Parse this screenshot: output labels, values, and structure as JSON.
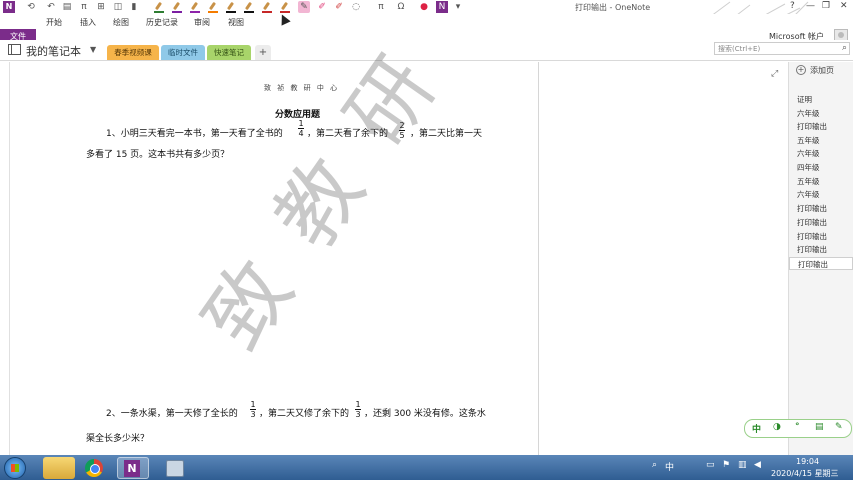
{
  "window": {
    "title": "打印输出 - OneNote",
    "account": "Microsoft 帐户"
  },
  "ribbon": {
    "file": "文件",
    "tabs": [
      "开始",
      "插入",
      "绘图",
      "历史记录",
      "审阅",
      "视图"
    ]
  },
  "quick_access_icons": [
    "back-icon",
    "pi-icon",
    "table-icon",
    "paint-icon"
  ],
  "pen_colors": [
    "#2e7d32",
    "#7b1fa2",
    "#8e24aa",
    "#f57c00",
    "#111111",
    "#111111",
    "#c62828",
    "#c62828"
  ],
  "notebook": {
    "name": "我的笔记本",
    "sections": [
      "春季视频课",
      "临时文件",
      "快速笔记"
    ],
    "add_section": "+"
  },
  "search": {
    "placeholder": "搜索(Ctrl+E)"
  },
  "pages_panel": {
    "add_page": "添加页",
    "pages": [
      "证明",
      "六年级",
      "打印输出",
      "五年级",
      "六年级",
      "四年级",
      "五年级",
      "六年级",
      "打印输出",
      "打印输出",
      "打印输出",
      "打印输出",
      "打印输出"
    ],
    "selected_index": 12
  },
  "document": {
    "header": "致 祯 教 研 中 心",
    "title": "分数应用题",
    "q1": {
      "part1": "1、小明三天看完一本书，第一天看了全书的",
      "frac1": {
        "num": "1",
        "den": "4"
      },
      "part2": "，第二天看了余下的",
      "frac2": {
        "num": "2",
        "den": "5"
      },
      "part3": "，第二天比第一天",
      "line2": "多看了 15 页。这本书共有多少页？"
    },
    "q2": {
      "part1": "2、一条水渠，第一天修了全长的",
      "frac1": {
        "num": "1",
        "den": "3"
      },
      "part2": "，第二天又修了余下的",
      "frac2": {
        "num": "1",
        "den": "3"
      },
      "part3": "，还剩 300 米没有修。这条水",
      "line2": "渠全长多少米？"
    },
    "watermark": "致 教 研"
  },
  "ime": {
    "mode": "中"
  },
  "taskbar": {
    "tray_lang": "中",
    "time": "19:04",
    "date": "2020/4/15 星期三"
  }
}
